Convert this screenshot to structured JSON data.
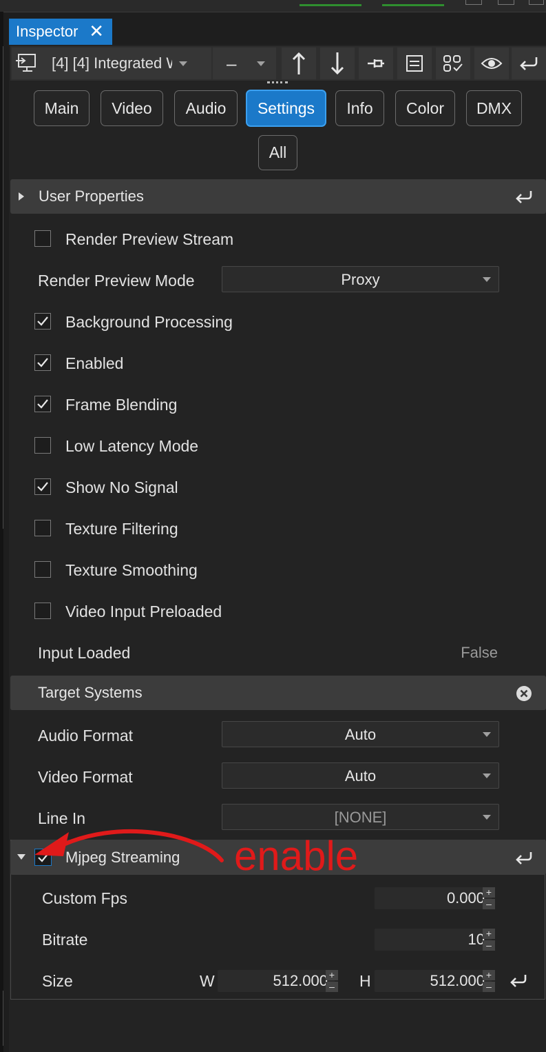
{
  "window": {
    "tab_title": "Inspector",
    "tab_close_icon": "close-icon"
  },
  "toolbar": {
    "item_selector": "[4] [4] Integrated W",
    "second_selector": "–"
  },
  "category_tabs": [
    "Main",
    "Video",
    "Audio",
    "Settings",
    "Info",
    "Color",
    "DMX",
    "All"
  ],
  "active_tab": "Settings",
  "sections": {
    "user_properties": "User Properties",
    "target_systems": "Target Systems",
    "mjpeg_streaming": "Mjpeg Streaming"
  },
  "settings": {
    "render_preview_stream": {
      "label": "Render Preview Stream",
      "checked": false
    },
    "render_preview_mode": {
      "label": "Render Preview Mode",
      "value": "Proxy"
    },
    "background_processing": {
      "label": "Background Processing",
      "checked": true
    },
    "enabled": {
      "label": "Enabled",
      "checked": true
    },
    "frame_blending": {
      "label": "Frame Blending",
      "checked": true
    },
    "low_latency_mode": {
      "label": "Low Latency Mode",
      "checked": false
    },
    "show_no_signal": {
      "label": "Show No Signal",
      "checked": true
    },
    "texture_filtering": {
      "label": "Texture Filtering",
      "checked": false
    },
    "texture_smoothing": {
      "label": "Texture Smoothing",
      "checked": false
    },
    "video_input_preloaded": {
      "label": "Video Input Preloaded",
      "checked": false
    },
    "input_loaded": {
      "label": "Input Loaded",
      "value": "False"
    }
  },
  "target_systems": {
    "audio_format": {
      "label": "Audio Format",
      "value": "Auto"
    },
    "video_format": {
      "label": "Video Format",
      "value": "Auto"
    },
    "line_in": {
      "label": "Line In",
      "value": "[NONE]"
    }
  },
  "mjpeg": {
    "checked": true,
    "custom_fps": {
      "label": "Custom Fps",
      "value": "0.000"
    },
    "bitrate": {
      "label": "Bitrate",
      "value": "10"
    },
    "size": {
      "label": "Size",
      "w_label": "W",
      "w_value": "512.000",
      "h_label": "H",
      "h_value": "512.000"
    }
  },
  "annotation": {
    "text": "enable",
    "color": "#e01a1a"
  },
  "colors": {
    "accent": "#1b79c9",
    "panel": "#232323",
    "section_header": "#3c3c3c"
  }
}
